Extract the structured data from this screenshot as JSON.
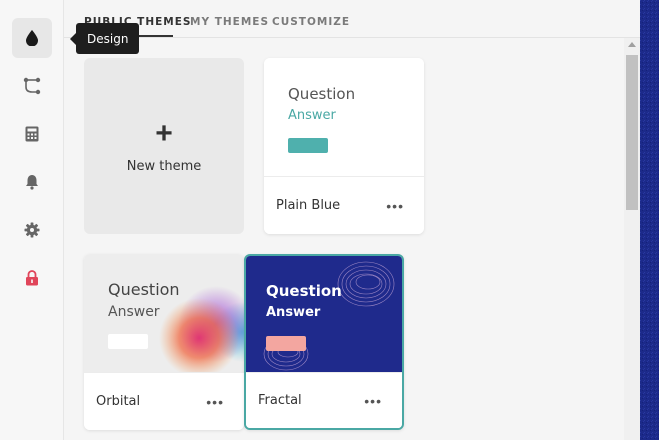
{
  "tooltip": {
    "text": "Design"
  },
  "rail": {
    "items": [
      {
        "icon": "drop-icon",
        "active": true
      },
      {
        "icon": "flow-icon"
      },
      {
        "icon": "calculator-icon"
      },
      {
        "icon": "bell-icon"
      },
      {
        "icon": "gear-icon"
      },
      {
        "icon": "lock-icon",
        "color": "#e0455a"
      }
    ]
  },
  "tabs": [
    "PUBLIC THEMES",
    "MY THEMES",
    "CUSTOMIZE"
  ],
  "new_theme": {
    "label": "New theme",
    "plus": "+"
  },
  "themes": [
    {
      "name": "Plain Blue",
      "question": "Question",
      "answer": "Answer",
      "answer_color": "#4aa8a4",
      "button_color": "#4fb0ad",
      "menu": "•••"
    },
    {
      "name": "Orbital",
      "question": "Question",
      "answer": "Answer",
      "menu": "•••"
    },
    {
      "name": "Fractal",
      "question": "Question",
      "answer": "Answer",
      "button_color": "#f3a6a0",
      "menu": "•••",
      "selected": true
    }
  ],
  "colors": {
    "accent": "#4aa8a4",
    "fractal_bg": "#1f2a8c",
    "right_edge": "#1c2a8a"
  }
}
